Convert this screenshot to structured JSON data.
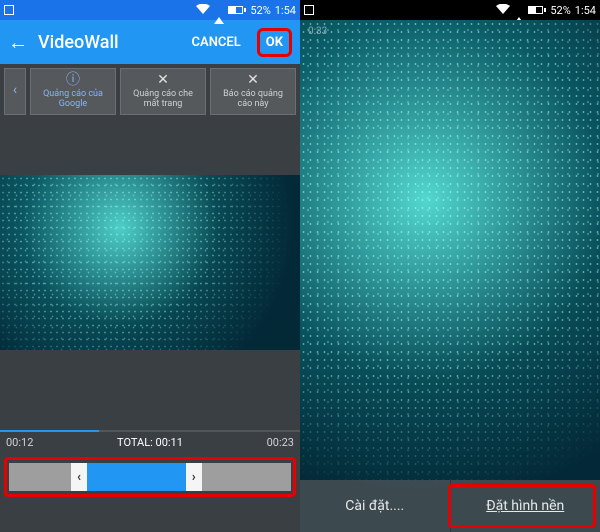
{
  "left": {
    "statusbar": {
      "battery_pct": "52%",
      "time": "1:54"
    },
    "appbar": {
      "title": "VideoWall",
      "cancel": "CANCEL",
      "ok": "OK"
    },
    "ads": {
      "cell1_line1": "Quảng cáo của",
      "cell1_line2": "Google",
      "cell2_line1": "Quảng cáo che",
      "cell2_line2": "mất trang",
      "cell3_line1": "Báo cáo quảng",
      "cell3_line2": "cáo này"
    },
    "timeline": {
      "start": "00:12",
      "total_label": "TOTAL:",
      "total_value": "00:11",
      "end": "00:23"
    }
  },
  "right": {
    "statusbar": {
      "battery_pct": "52%",
      "time": "1:54"
    },
    "overlay_time": "0:33",
    "buttons": {
      "settings": "Cài đặt....",
      "set_wallpaper": "Đặt hình nền"
    }
  }
}
